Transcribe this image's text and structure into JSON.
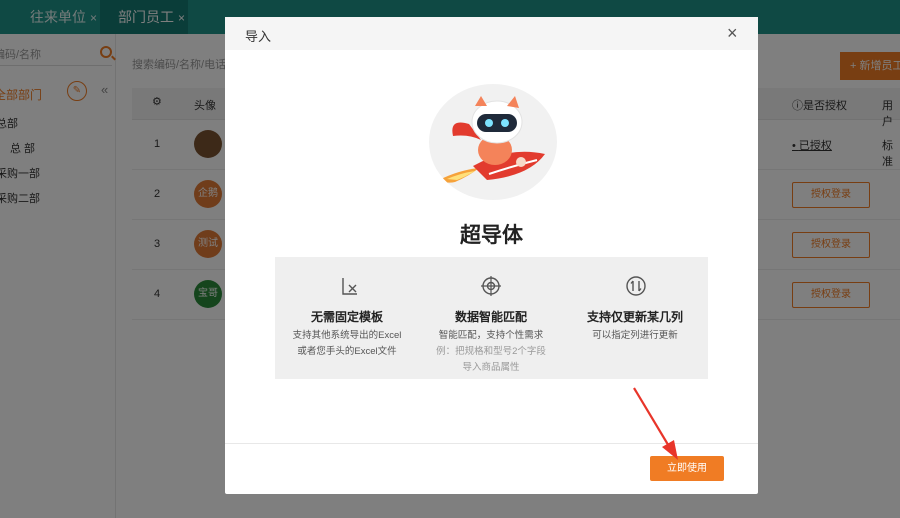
{
  "tabs": [
    {
      "label": "往来单位",
      "close": "×"
    },
    {
      "label": "部门员工",
      "close": "×"
    }
  ],
  "sidebar": {
    "search_placeholder": "编码/名称",
    "root": "全部部门",
    "items": [
      "总部",
      "总 部",
      "采购一部",
      "采购二部"
    ]
  },
  "main": {
    "search_placeholder": "搜索编码/名称/电话",
    "add_button": "+ 新增员工",
    "columns": {
      "avatar": "头像",
      "authorized": "是否授权",
      "user": "用户"
    },
    "rows": [
      {
        "num": "1",
        "avatar": "",
        "avatar_color": "#7a5230",
        "auth": "已授权",
        "user": "标准"
      },
      {
        "num": "2",
        "avatar": "企鹅",
        "avatar_color": "#e07a36",
        "auth": "授权登录",
        "user": ""
      },
      {
        "num": "3",
        "avatar": "测试",
        "avatar_color": "#e07a36",
        "auth": "授权登录",
        "user": ""
      },
      {
        "num": "4",
        "avatar": "宝哥",
        "avatar_color": "#2a8a3a",
        "auth": "授权登录",
        "user": ""
      }
    ]
  },
  "modal": {
    "title": "导入",
    "close": "×",
    "product_name": "超导体",
    "features": [
      {
        "icon": "no-template-icon",
        "title": "无需固定模板",
        "desc": [
          "支持其他系统导出的Excel",
          "或者您手头的Excel文件"
        ],
        "note": []
      },
      {
        "icon": "target-icon",
        "title": "数据智能匹配",
        "desc": [
          "智能匹配，支持个性需求"
        ],
        "note": [
          "例：把规格和型号2个字段",
          "导入商品属性"
        ]
      },
      {
        "icon": "sort-icon",
        "title": "支持仅更新某几列",
        "desc": [
          "可以指定列进行更新"
        ],
        "note": []
      }
    ],
    "use_button": "立即使用"
  },
  "colors": {
    "brand": "#1f9289",
    "accent": "#f07c24",
    "annotation": "#e8352a"
  }
}
